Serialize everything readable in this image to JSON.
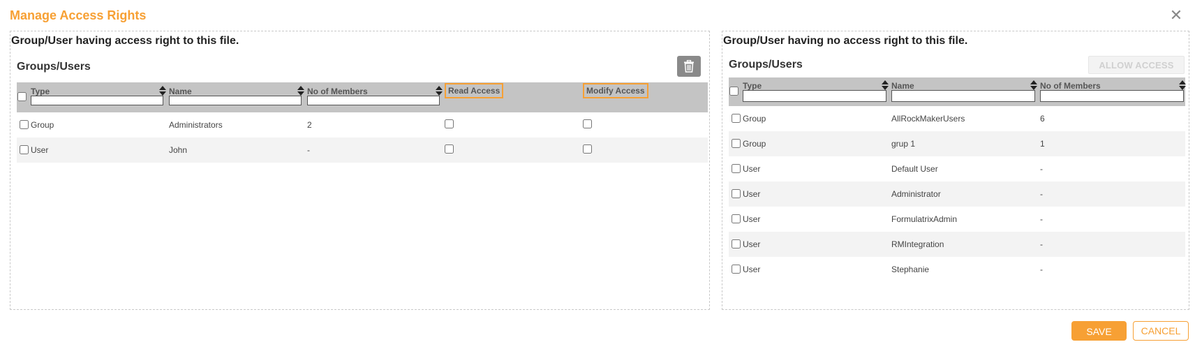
{
  "dialog": {
    "title": "Manage Access Rights",
    "close_icon": "close-icon"
  },
  "left_panel": {
    "heading": "Group/User having access right to this file.",
    "section_title": "Groups/Users",
    "delete_icon": "trash-icon",
    "columns": {
      "type": "Type",
      "name": "Name",
      "members": "No of Members",
      "read": "Read Access",
      "modify": "Modify Access"
    },
    "rows": [
      {
        "type": "Group",
        "name": "Administrators",
        "members": "2"
      },
      {
        "type": "User",
        "name": "John",
        "members": "-"
      }
    ]
  },
  "right_panel": {
    "heading": "Group/User having no access right to this file.",
    "section_title": "Groups/Users",
    "allow_button": "ALLOW ACCESS",
    "columns": {
      "type": "Type",
      "name": "Name",
      "members": "No of Members"
    },
    "rows": [
      {
        "type": "Group",
        "name": "AllRockMakerUsers",
        "members": "6"
      },
      {
        "type": "Group",
        "name": "grup 1",
        "members": "1"
      },
      {
        "type": "User",
        "name": "Default User",
        "members": "-"
      },
      {
        "type": "User",
        "name": "Administrator",
        "members": "-"
      },
      {
        "type": "User",
        "name": "FormulatrixAdmin",
        "members": "-"
      },
      {
        "type": "User",
        "name": "RMIntegration",
        "members": "-"
      },
      {
        "type": "User",
        "name": "Stephanie",
        "members": "-"
      }
    ]
  },
  "footer": {
    "save": "SAVE",
    "cancel": "CANCEL"
  },
  "colors": {
    "accent": "#f7a034",
    "header_bg": "#c4c4c4",
    "alt_row": "#f3f3f3"
  }
}
